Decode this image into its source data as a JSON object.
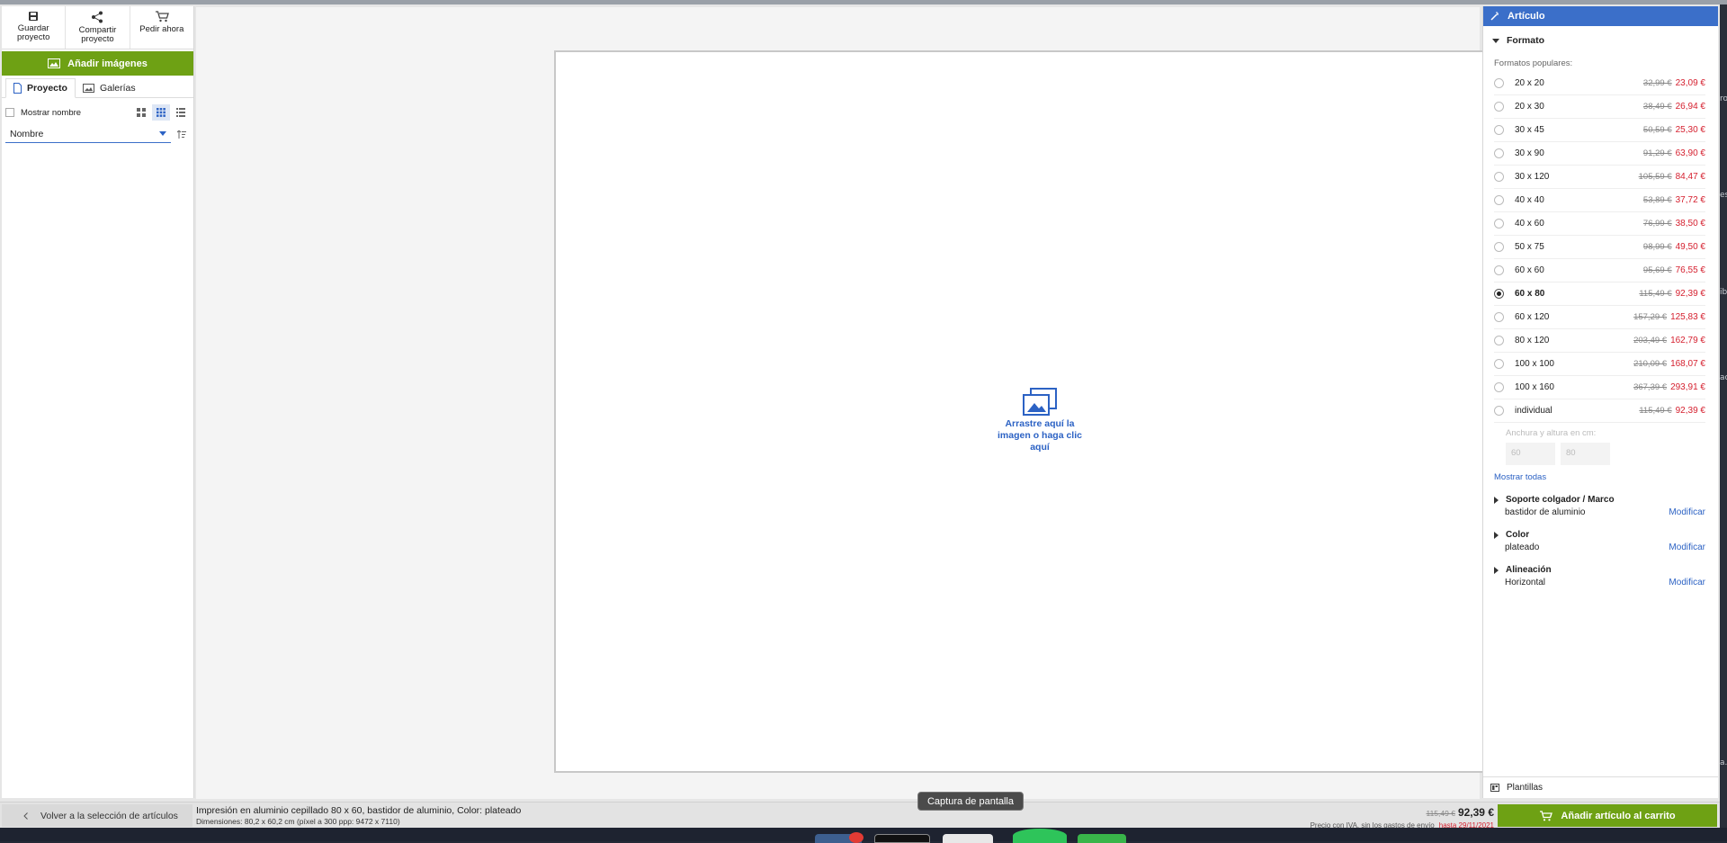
{
  "toolbar": {
    "save": "Guardar proyecto",
    "share": "Compartir proyecto",
    "order": "Pedir ahora"
  },
  "add_images": "Añadir imágenes",
  "tabs": [
    "Proyecto",
    "Galerías"
  ],
  "show_name": "Mostrar nombre",
  "sort": {
    "value": "Nombre"
  },
  "canvas": {
    "drop_text": "Arrastre aquí la imagen o haga clic aquí"
  },
  "panel": {
    "title": "Artículo",
    "format_title": "Formato",
    "popular_label": "Formatos populares:",
    "formats": [
      {
        "name": "20 x 20",
        "old": "32,99 €",
        "new": "23,09 €"
      },
      {
        "name": "20 x 30",
        "old": "38,49 €",
        "new": "26,94 €"
      },
      {
        "name": "30 x 45",
        "old": "50,59 €",
        "new": "25,30 €"
      },
      {
        "name": "30 x 90",
        "old": "91,29 €",
        "new": "63,90 €"
      },
      {
        "name": "30 x 120",
        "old": "105,59 €",
        "new": "84,47 €"
      },
      {
        "name": "40 x 40",
        "old": "53,89 €",
        "new": "37,72 €"
      },
      {
        "name": "40 x 60",
        "old": "76,99 €",
        "new": "38,50 €"
      },
      {
        "name": "50 x 75",
        "old": "98,99 €",
        "new": "49,50 €"
      },
      {
        "name": "60 x 60",
        "old": "95,69 €",
        "new": "76,55 €"
      },
      {
        "name": "60 x 80",
        "old": "115,49 €",
        "new": "92,39 €"
      },
      {
        "name": "60 x 120",
        "old": "157,29 €",
        "new": "125,83 €"
      },
      {
        "name": "80 x 120",
        "old": "203,49 €",
        "new": "162,79 €"
      },
      {
        "name": "100 x 100",
        "old": "210,09 €",
        "new": "168,07 €"
      },
      {
        "name": "100 x 160",
        "old": "367,39 €",
        "new": "293,91 €"
      },
      {
        "name": "individual",
        "old": "115,49 €",
        "new": "92,39 €"
      }
    ],
    "selected_format": "60 x 80",
    "custom_label": "Anchura y altura en cm:",
    "custom_width": "60",
    "custom_height": "80",
    "show_all": "Mostrar todas",
    "options": [
      {
        "title": "Soporte colgador / Marco",
        "value": "bastidor de aluminio",
        "action": "Modificar"
      },
      {
        "title": "Color",
        "value": "plateado",
        "action": "Modificar"
      },
      {
        "title": "Alineación",
        "value": "Horizontal",
        "action": "Modificar"
      }
    ],
    "templates": "Plantillas"
  },
  "bottom": {
    "back": "Volver a la selección de artículos",
    "description": "Impresión en aluminio cepillado 80 x 60, bastidor de aluminio, Color: plateado",
    "dimensions": "Dimensiones: 80,2 x 60,2 cm (píxel a 300 ppp: 9472 x 7110)",
    "old_price": "115,49 €",
    "price": "92,39 €",
    "price_note": "Precio con IVA, sin los gastos de envío",
    "valid_until": "hasta 29/11/2021",
    "add_to_cart": "Añadir artículo al carrito"
  },
  "tooltip": "Captura de pantalla",
  "colors": {
    "accent_blue": "#3b6fc9",
    "green": "#6ea114",
    "sale_red": "#d51f2e"
  }
}
